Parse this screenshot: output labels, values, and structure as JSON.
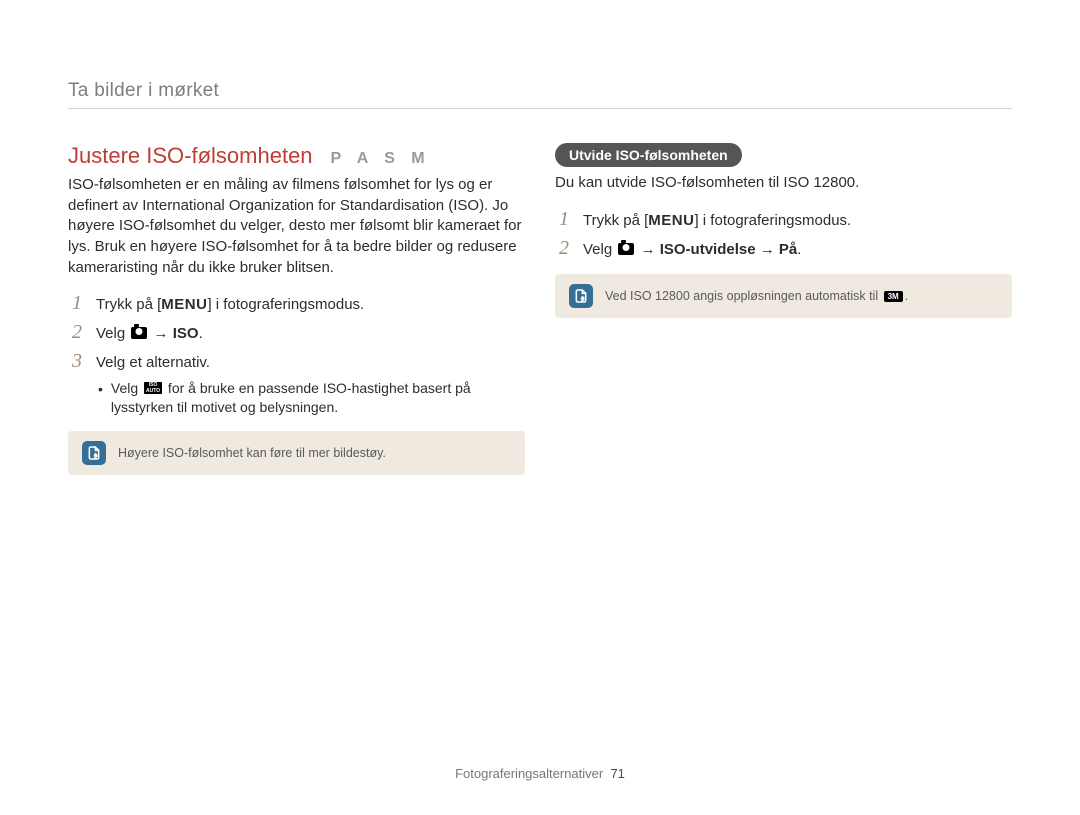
{
  "header": {
    "title": "Ta bilder i mørket"
  },
  "left": {
    "title": "Justere ISO-følsomheten",
    "modes": "P A S M",
    "intro": "ISO-følsomheten er en måling av filmens følsomhet for lys og er definert av International Organization for Standardisation (ISO). Jo høyere ISO-følsomhet du velger, desto mer følsomt blir kameraet for lys. Bruk en høyere ISO-følsomhet for å ta bedre bilder og redusere kameraristing når du ikke bruker blitsen.",
    "steps": {
      "s1_pre": "Trykk på [",
      "menu": "MENU",
      "s1_post": "] i fotograferingsmodus.",
      "s2_pre": "Velg ",
      "s2_arrow": " → ",
      "s2_iso": "ISO",
      "s2_dot": ".",
      "s3": "Velg et alternativ."
    },
    "bullet": {
      "pre": "Velg ",
      "post": " for å bruke en passende ISO-hastighet basert på lysstyrken til motivet og belysningen."
    },
    "note": "Høyere ISO-følsomhet kan føre til mer bildestøy."
  },
  "right": {
    "pill": "Utvide ISO-følsomheten",
    "intro": "Du kan utvide ISO-følsomheten til ISO 12800.",
    "steps": {
      "s1_pre": "Trykk på [",
      "menu": "MENU",
      "s1_post": "] i fotograferingsmodus.",
      "s2_pre": "Velg ",
      "s2_arrow": " → ",
      "s2_part1": "ISO-utvidelse",
      "s2_arrow2": " → ",
      "s2_part2": "På",
      "s2_dot": "."
    },
    "note_pre": "Ved ISO 12800 angis oppløsningen automatisk til ",
    "note_post": "."
  },
  "icons": {
    "iso_auto_top": "ISO",
    "iso_auto_bottom": "AUTO",
    "res_label": "3M"
  },
  "footer": {
    "label": "Fotograferingsalternativer",
    "page": "71"
  }
}
